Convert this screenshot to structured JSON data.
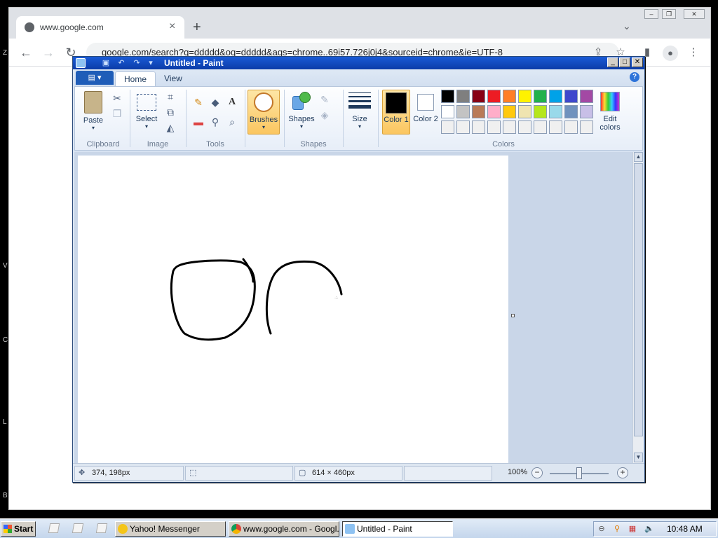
{
  "browser": {
    "tab_title": "www.google.com",
    "tab_close": "×",
    "new_tab": "+",
    "tab_search": "⌄",
    "url": "google.com/search?q=ddddd&oq=ddddd&aqs=chrome..69i57.726j0j4&sourceid=chrome&ie=UTF-8",
    "back": "←",
    "forward": "→",
    "reload": "↻",
    "edge_letters": [
      "Z",
      "V",
      "C",
      "L",
      "B"
    ]
  },
  "paint": {
    "title": "Untitled - Paint",
    "tabs": [
      "Home",
      "View"
    ],
    "help": "?",
    "groups": {
      "clipboard": "Clipboard",
      "image": "Image",
      "tools": "Tools",
      "shapes": "Shapes",
      "colors": "Colors"
    },
    "buttons": {
      "paste": "Paste",
      "select": "Select",
      "brushes": "Brushes",
      "shapes": "Shapes",
      "size": "Size",
      "color1": "Color 1",
      "color2": "Color 2",
      "edit_colors": "Edit colors"
    },
    "palette_row1": [
      "#000000",
      "#7f7f7f",
      "#880015",
      "#ed1c24",
      "#ff7f27",
      "#fff200",
      "#22b14c",
      "#00a2e8",
      "#3f48cc",
      "#a349a4"
    ],
    "palette_row2": [
      "#ffffff",
      "#c3c3c3",
      "#b97a57",
      "#ffaec9",
      "#ffc90e",
      "#efe4b0",
      "#b5e61d",
      "#99d9ea",
      "#7092be",
      "#c8bfe7"
    ],
    "palette_row3": [
      "#f0f0f0",
      "#f0f0f0",
      "#f0f0f0",
      "#f0f0f0",
      "#f0f0f0",
      "#f0f0f0",
      "#f0f0f0",
      "#f0f0f0",
      "#f0f0f0",
      "#f0f0f0"
    ],
    "color1": "#000000",
    "color2": "#ffffff",
    "status": {
      "cursor_pos": "374, 198px",
      "selection": "",
      "canvas_size": "614 × 460px",
      "zoom": "100%"
    }
  },
  "taskbar": {
    "start": "Start",
    "tasks": [
      {
        "label": "Yahoo! Messenger"
      },
      {
        "label": "www.google.com - Googl..."
      },
      {
        "label": "Untitled - Paint"
      }
    ],
    "clock": "10:48 AM"
  }
}
